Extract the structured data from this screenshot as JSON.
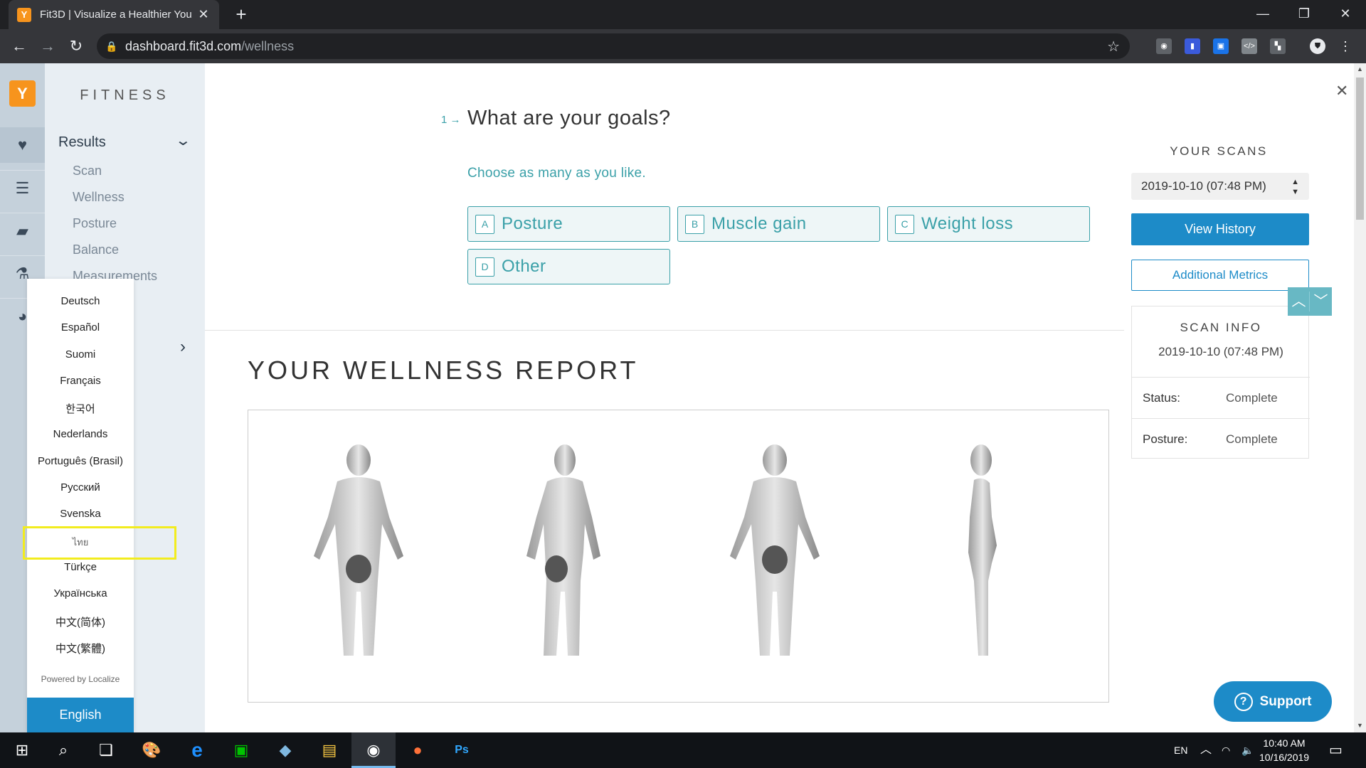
{
  "browser": {
    "tab_title": "Fit3D | Visualize a Healthier You",
    "url_host": "dashboard.fit3d.com",
    "url_path": "/wellness"
  },
  "sidebar": {
    "section_title": "FITNESS",
    "results_label": "Results",
    "sub_items": [
      "Scan",
      "Wellness",
      "Posture",
      "Balance",
      "Measurements"
    ]
  },
  "language_menu": {
    "options": [
      "Deutsch",
      "Español",
      "Suomi",
      "Français",
      "한국어",
      "Nederlands",
      "Português (Brasil)",
      "Русский",
      "Svenska",
      "ไทย",
      "Türkçe",
      "Українська",
      "中文(简体)",
      "中文(繁體)"
    ],
    "highlighted": "ไทย",
    "powered_by": "Powered by Localize",
    "current": "English"
  },
  "goals": {
    "step_number": "1",
    "title": "What are your goals?",
    "subtitle": "Choose as many as you like.",
    "options": [
      {
        "key": "A",
        "label": "Posture"
      },
      {
        "key": "B",
        "label": "Muscle gain"
      },
      {
        "key": "C",
        "label": "Weight loss"
      },
      {
        "key": "D",
        "label": "Other"
      }
    ]
  },
  "report": {
    "title": "YOUR WELLNESS REPORT"
  },
  "scans_panel": {
    "heading": "YOUR SCANS",
    "selected_scan": "2019-10-10 (07:48 PM)",
    "view_history": "View History",
    "additional_metrics": "Additional Metrics"
  },
  "scan_info": {
    "heading": "SCAN INFO",
    "date": "2019-10-10 (07:48 PM)",
    "rows": [
      {
        "key": "Status:",
        "value": "Complete"
      },
      {
        "key": "Posture:",
        "value": "Complete"
      }
    ]
  },
  "support": {
    "label": "Support"
  },
  "taskbar": {
    "lang": "EN",
    "time": "10:40 AM",
    "date": "10/16/2019"
  },
  "colors": {
    "accent_teal": "#3aa0a8",
    "primary_blue": "#1d8bc8",
    "brand_orange": "#f7941d",
    "highlight_yellow": "#f2ec1e"
  }
}
